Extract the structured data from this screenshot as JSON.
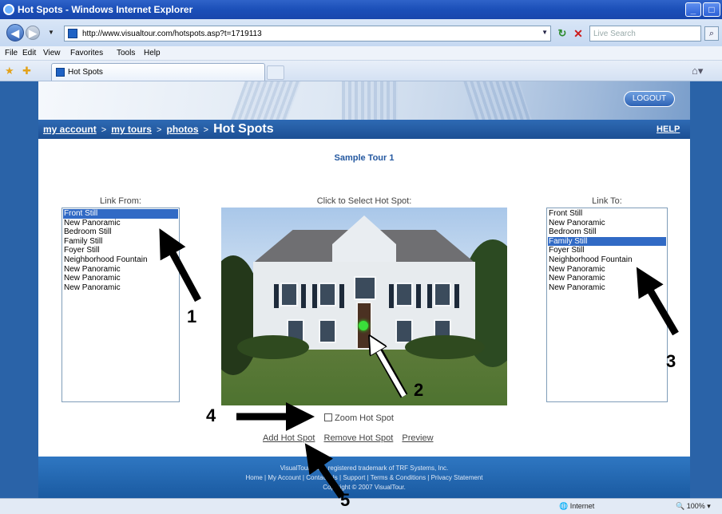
{
  "window": {
    "title": "Hot Spots - Windows Internet Explorer",
    "min_label": "_",
    "max_label": "□"
  },
  "address": {
    "url": "http://www.visualtour.com/hotspots.asp?t=1719113",
    "search_placeholder": "Live Search"
  },
  "menu": [
    "File",
    "Edit",
    "View",
    "Favorites",
    "Tools",
    "Help"
  ],
  "tab": {
    "label": "Hot Spots"
  },
  "site": {
    "logout": "LOGOUT",
    "breadcrumb": {
      "my_account": "my account",
      "my_tours": "my tours",
      "photos": "photos",
      "sep": ">",
      "current": "Hot Spots"
    },
    "help": "HELP",
    "tour_title": "Sample Tour 1",
    "link_from_label": "Link From:",
    "click_label": "Click to Select Hot Spot:",
    "link_to_label": "Link To:",
    "link_from": [
      "Front Still",
      "New Panoramic",
      "Bedroom Still",
      "Family Still",
      "Foyer Still",
      "Neighborhood Fountain",
      "New Panoramic",
      "New Panoramic",
      "New Panoramic"
    ],
    "link_from_selected": "Front Still",
    "link_to": [
      "Front Still",
      "New Panoramic",
      "Bedroom Still",
      "Family Still",
      "Foyer Still",
      "Neighborhood Fountain",
      "New Panoramic",
      "New Panoramic",
      "New Panoramic"
    ],
    "link_to_selected": "Family Still",
    "zoom_label": "Zoom Hot Spot",
    "zoom_checked": false,
    "actions": {
      "add": "Add Hot Spot",
      "remove": "Remove Hot Spot",
      "preview": "Preview"
    },
    "footer": {
      "line1": "VisualTour® is a registered trademark of TRF Systems, Inc.",
      "line2": "Home | My Account | Contact Us | Support | Terms & Conditions | Privacy Statement",
      "line3": "Copyright © 2007 VisualTour."
    }
  },
  "status": {
    "zone": "Internet",
    "zoom": "100%"
  },
  "annotations": [
    "1",
    "2",
    "3",
    "4",
    "5"
  ],
  "colors": {
    "accent": "#2a63a8",
    "selection": "#316ac5",
    "hotspot": "#3adf3a"
  }
}
